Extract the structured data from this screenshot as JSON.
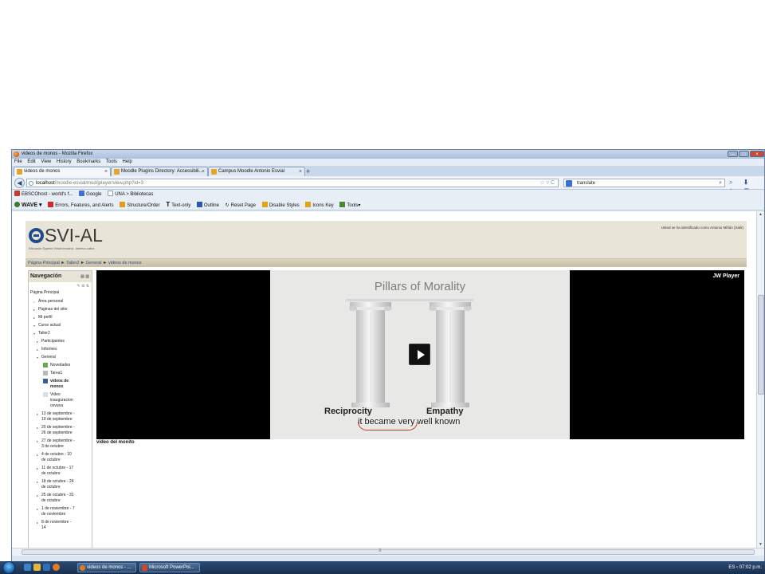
{
  "window": {
    "title": "videos de monos - Mozilla Firefox",
    "controls": [
      "–",
      "□",
      "×"
    ]
  },
  "menubar": [
    "File",
    "Edit",
    "View",
    "History",
    "Bookmarks",
    "Tools",
    "Help"
  ],
  "tabs": [
    {
      "label": "videos de monos",
      "active": true
    },
    {
      "label": "Moodle Plugins Directory: Accessibili...",
      "active": false
    },
    {
      "label": "Campus Moodle Antonio Esvial",
      "active": false
    }
  ],
  "newtab": "+",
  "urlbar": {
    "host": "localhost",
    "path": "/moodle-esvial/mod/jplayer/view.php?id=3",
    "icons": "☆ ▿ C"
  },
  "search": {
    "value": "translate"
  },
  "navicons": "⌕ ⬇ ⌂ ✉ ▾",
  "bookmarks": [
    {
      "label": "EBSCOhost - world's f...",
      "color": "#c53b2b"
    },
    {
      "label": "Google",
      "color": "#3a6fd4"
    },
    {
      "label": "UNA > Bibliotecas",
      "color": "#ffffff"
    }
  ],
  "wave": {
    "label": "WAVE ▾",
    "items": [
      "Errors, Features, and Alerts",
      "Structure/Order",
      "Text-only",
      "Outline",
      "Reset Page",
      "Disable Styles",
      "Icons Key",
      "Tools▾"
    ],
    "colors": [
      "#d02a2a",
      "#e09a1c",
      "#222222",
      "#2a5ab0",
      "#555555",
      "#e0a31c",
      "#e0a31c",
      "#4b8a2b"
    ]
  },
  "moodle": {
    "logo": "SVI-AL",
    "tagline": "Educación Superior Virtual Inclusiva - América Latina",
    "loginfo": "Usted se ha identificado como Antonio Miñán (Salir)",
    "breadcrumb": [
      "Página Principal",
      "Taller2",
      "General",
      "videos de monos"
    ],
    "breadcrumb_sep": "►",
    "nav": {
      "title": "Navegación",
      "items": [
        {
          "label": "Página Principal",
          "level": 0,
          "mark": ""
        },
        {
          "label": "Área personal",
          "level": 1,
          "mark": "•"
        },
        {
          "label": "Páginas del sitio",
          "level": 1,
          "mark": "▸"
        },
        {
          "label": "Mi perfil",
          "level": 1,
          "mark": "▸"
        },
        {
          "label": "Curso actual",
          "level": 1,
          "mark": "▾"
        },
        {
          "label": "Taller2",
          "level": 2,
          "mark": "▾"
        },
        {
          "label": "Participantes",
          "level": 3,
          "mark": "▸"
        },
        {
          "label": "Informes",
          "level": 3,
          "mark": "▸"
        },
        {
          "label": "General",
          "level": 3,
          "mark": "▾"
        },
        {
          "label": "Novedades",
          "level": 4,
          "mark": "forum"
        },
        {
          "label": "Tarea1",
          "level": 4,
          "mark": "assign"
        },
        {
          "label": "videos de monos",
          "level": 4,
          "mark": "video",
          "bold": true
        },
        {
          "label": "Video inauguracion cevuna",
          "level": 4,
          "mark": "page"
        },
        {
          "label": "13 de septiembre - 19 de septiembre",
          "level": 3,
          "mark": "▸"
        },
        {
          "label": "20 de septiembre - 26 de septiembre",
          "level": 3,
          "mark": "▸"
        },
        {
          "label": "27 de septiembre - 3 de octubre",
          "level": 3,
          "mark": "▸"
        },
        {
          "label": "4 de octubre - 10 de octubre",
          "level": 3,
          "mark": "▸"
        },
        {
          "label": "11 de octubre - 17 de octubre",
          "level": 3,
          "mark": "▸"
        },
        {
          "label": "18 de octubre - 24 de octubre",
          "level": 3,
          "mark": "▸"
        },
        {
          "label": "25 de octubre - 31 de octubre",
          "level": 3,
          "mark": "▸"
        },
        {
          "label": "1 de noviembre - 7 de noviembre",
          "level": 3,
          "mark": "▸"
        },
        {
          "label": "8 de noviembre - 14",
          "level": 3,
          "mark": "▸"
        }
      ]
    },
    "video": {
      "player": "JW Player",
      "title": "Pillars of Morality",
      "pillar_left": "Reciprocity",
      "pillar_right": "Empathy",
      "subtitle": "it became very well known",
      "caption": "video del monito"
    }
  },
  "taskbar": {
    "buttons": [
      "videos de monos - ...",
      "Microsoft PowerPoi..."
    ],
    "tray": "ES  ‹  07:02 p.m."
  }
}
